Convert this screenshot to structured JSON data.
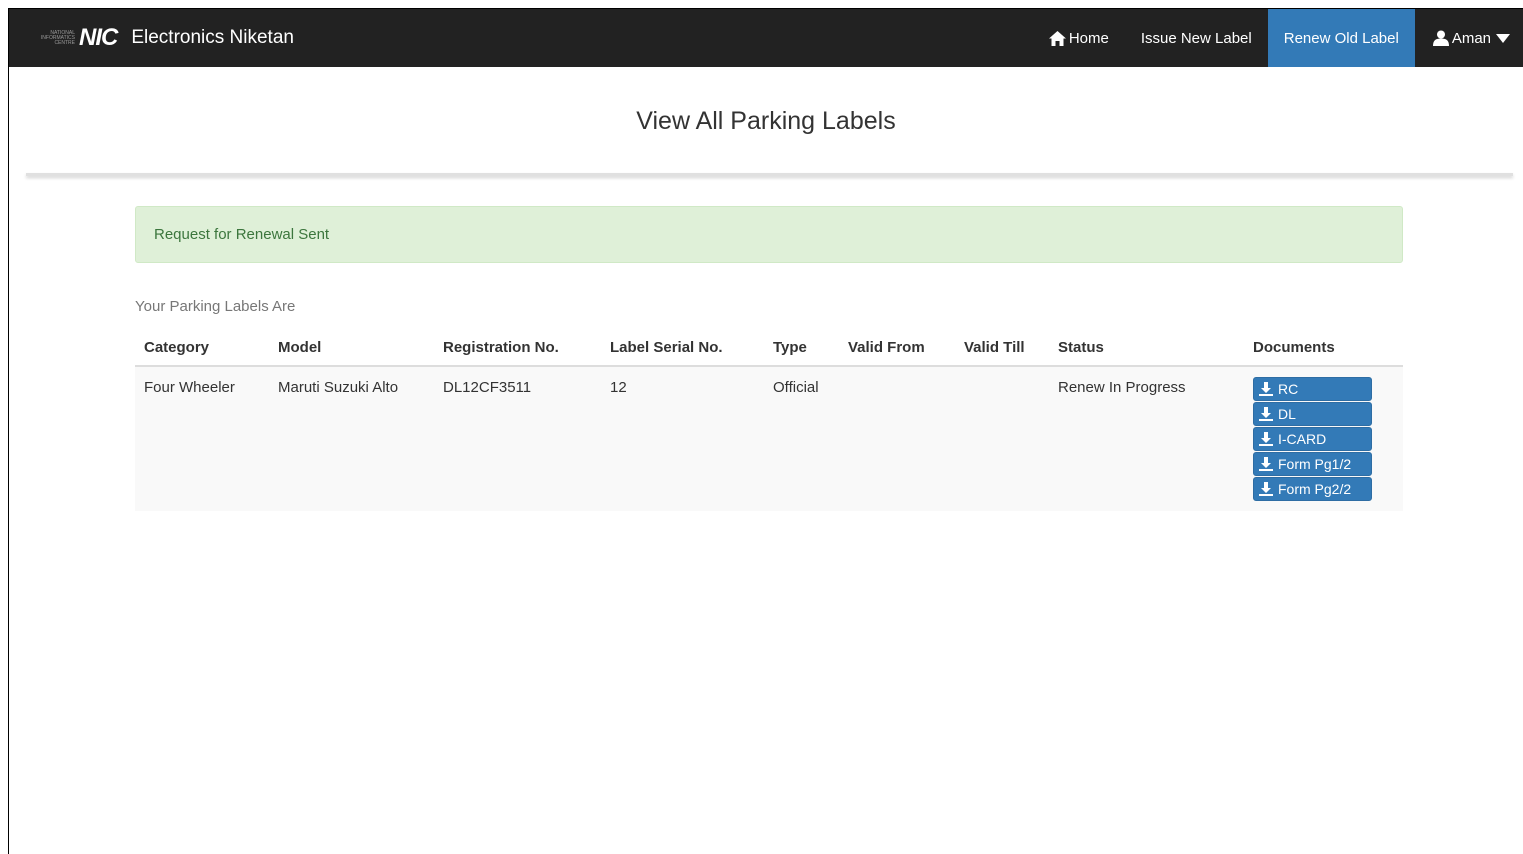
{
  "navbar": {
    "logo_small_text": "NATIONAL INFORMATICS CENTRE",
    "logo_mark": "NIC",
    "brand_title": "Electronics Niketan",
    "items": [
      {
        "label": "Home",
        "icon": "home-icon"
      },
      {
        "label": "Issue New Label"
      },
      {
        "label": "Renew Old Label",
        "active": true
      }
    ],
    "user": {
      "label": "Aman",
      "icon": "user-icon"
    }
  },
  "page": {
    "title": "View All Parking Labels"
  },
  "alert": {
    "message": "Request for Renewal Sent",
    "color": "#3c763d"
  },
  "labels_section": {
    "subtitle": "Your Parking Labels Are",
    "columns": [
      "Category",
      "Model",
      "Registration No.",
      "Label Serial No.",
      "Type",
      "Valid From",
      "Valid Till",
      "Status",
      "Documents"
    ],
    "rows": [
      {
        "category": "Four Wheeler",
        "model": "Maruti Suzuki Alto",
        "registration_no": "DL12CF3511",
        "label_serial_no": "12",
        "type": "Official",
        "valid_from": "",
        "valid_till": "",
        "status": "Renew In Progress",
        "documents": [
          "RC",
          "DL",
          "I-CARD",
          "Form Pg1/2",
          "Form Pg2/2"
        ]
      }
    ]
  },
  "colors": {
    "navbar_bg": "#222222",
    "accent": "#337ab7",
    "alert_bg": "#dff0d8"
  }
}
